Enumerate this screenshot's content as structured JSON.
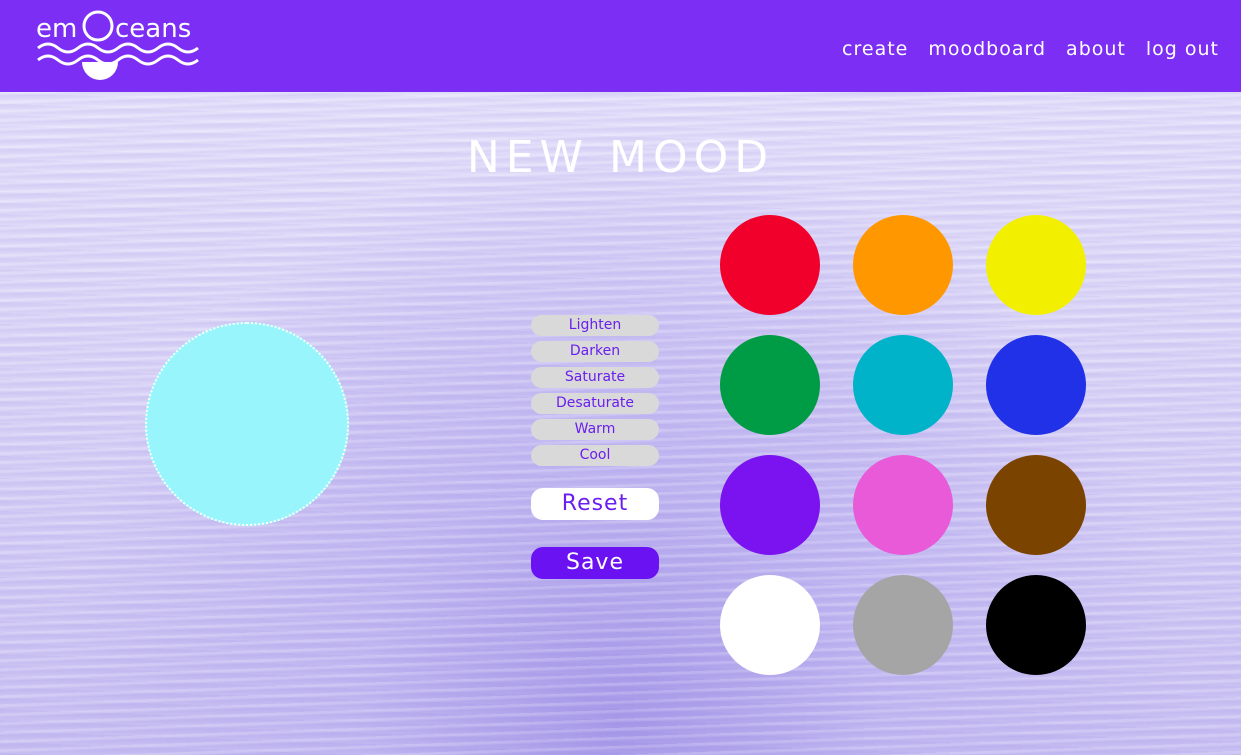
{
  "header": {
    "logo_text": "emOceans",
    "brand_color": "#7c2ef4",
    "nav": [
      "create",
      "moodboard",
      "about",
      "log out"
    ]
  },
  "page": {
    "title": "NEW MOOD"
  },
  "preview": {
    "color": "#98f5fb"
  },
  "adjustments": [
    "Lighten",
    "Darken",
    "Saturate",
    "Desaturate",
    "Warm",
    "Cool"
  ],
  "actions": {
    "reset_label": "Reset",
    "save_label": "Save"
  },
  "palette": [
    "#f0002a",
    "#ff9800",
    "#f2f000",
    "#009b45",
    "#00b3c8",
    "#2131e8",
    "#7b12f0",
    "#e95ad9",
    "#7b4300",
    "#ffffff",
    "#a5a5a5",
    "#000000"
  ]
}
